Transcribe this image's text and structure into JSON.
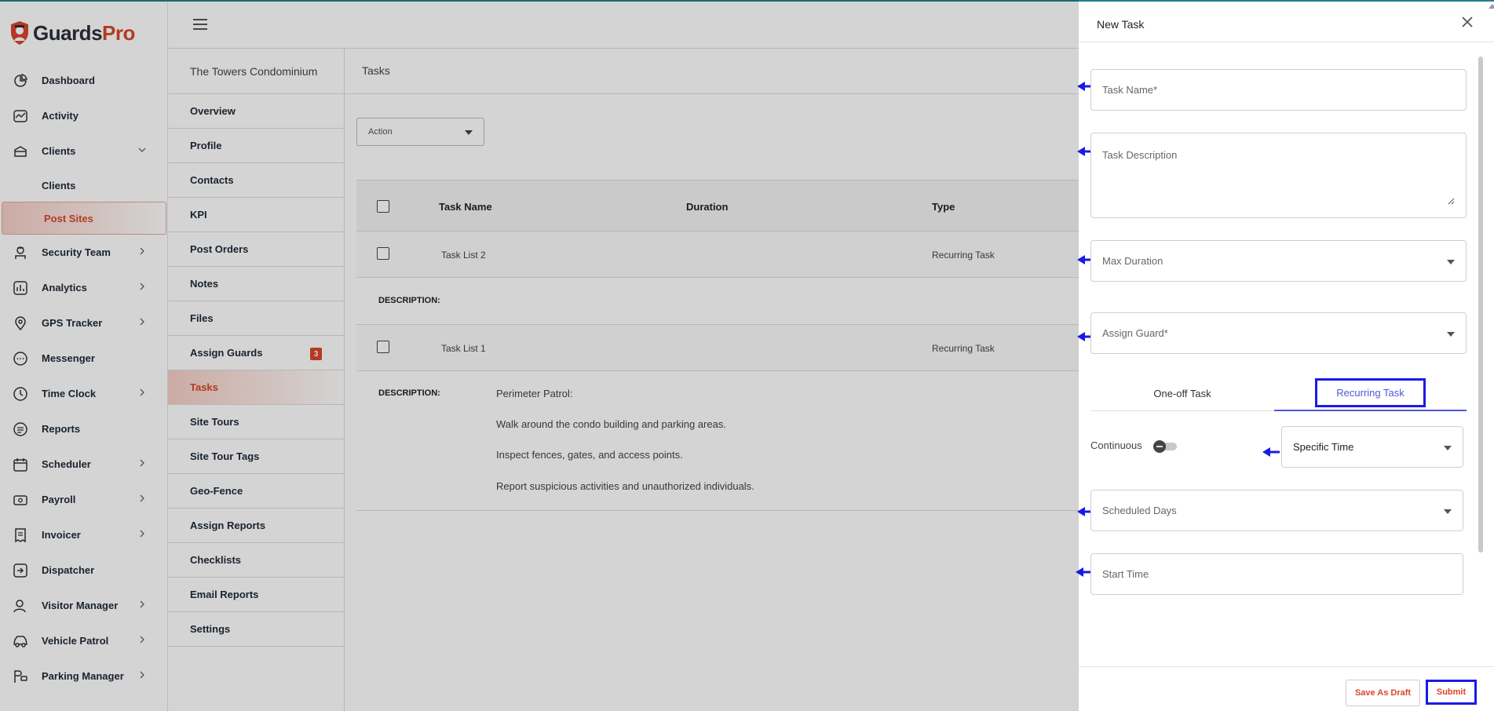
{
  "brand": {
    "name_part1": "Guards",
    "name_part2": "Pro",
    "accent": "#d9462b"
  },
  "sidebar": {
    "items": [
      {
        "label": "Dashboard",
        "icon": "dashboard-icon",
        "chevron": false
      },
      {
        "label": "Activity",
        "icon": "activity-icon",
        "chevron": false
      },
      {
        "label": "Clients",
        "icon": "clients-icon",
        "chevron": "down"
      },
      {
        "label": "Security Team",
        "icon": "security-team-icon",
        "chevron": "right"
      },
      {
        "label": "Analytics",
        "icon": "analytics-icon",
        "chevron": "right"
      },
      {
        "label": "GPS Tracker",
        "icon": "location-pin-icon",
        "chevron": "right"
      },
      {
        "label": "Messenger",
        "icon": "chat-icon",
        "chevron": false
      },
      {
        "label": "Time Clock",
        "icon": "clock-icon",
        "chevron": "right"
      },
      {
        "label": "Reports",
        "icon": "reports-icon",
        "chevron": false
      },
      {
        "label": "Scheduler",
        "icon": "calendar-icon",
        "chevron": "right"
      },
      {
        "label": "Payroll",
        "icon": "payroll-icon",
        "chevron": "right"
      },
      {
        "label": "Invoicer",
        "icon": "invoice-icon",
        "chevron": "right"
      },
      {
        "label": "Dispatcher",
        "icon": "dispatch-icon",
        "chevron": false
      },
      {
        "label": "Visitor Manager",
        "icon": "visitor-icon",
        "chevron": "right"
      },
      {
        "label": "Vehicle Patrol",
        "icon": "car-icon",
        "chevron": "right"
      },
      {
        "label": "Parking Manager",
        "icon": "parking-icon",
        "chevron": "right"
      }
    ],
    "sub_items": [
      "Clients",
      "Post Sites"
    ],
    "active_sub": "Post Sites"
  },
  "site_menu": {
    "title": "The Towers Condominium",
    "items": [
      {
        "label": "Overview"
      },
      {
        "label": "Profile"
      },
      {
        "label": "Contacts"
      },
      {
        "label": "KPI"
      },
      {
        "label": "Post Orders"
      },
      {
        "label": "Notes"
      },
      {
        "label": "Files"
      },
      {
        "label": "Assign Guards",
        "badge": "3"
      },
      {
        "label": "Tasks",
        "active": true
      },
      {
        "label": "Site Tours"
      },
      {
        "label": "Site Tour Tags"
      },
      {
        "label": "Geo-Fence"
      },
      {
        "label": "Assign Reports"
      },
      {
        "label": "Checklists"
      },
      {
        "label": "Email Reports"
      },
      {
        "label": "Settings"
      }
    ]
  },
  "main": {
    "title": "Tasks",
    "action_label": "Action",
    "columns": [
      "Task Name",
      "Duration",
      "Type"
    ],
    "rows": [
      {
        "name": "Task List 2",
        "duration": "",
        "type": "Recurring Task",
        "description_label": "DESCRIPTION:",
        "description": []
      },
      {
        "name": "Task List 1",
        "duration": "",
        "type": "Recurring Task",
        "description_label": "DESCRIPTION:",
        "description": [
          "Perimeter Patrol:",
          "Walk around the condo building and parking areas.",
          "Inspect fences, gates, and access points.",
          "Report suspicious activities and unauthorized individuals."
        ]
      }
    ]
  },
  "drawer": {
    "title": "New Task",
    "task_name_placeholder": "Task Name*",
    "task_description_placeholder": "Task Description",
    "max_duration_placeholder": "Max Duration",
    "assign_guard_placeholder": "Assign Guard*",
    "tabs": [
      "One-off Task",
      "Recurring Task"
    ],
    "active_tab": "Recurring Task",
    "continuous_label": "Continuous",
    "continuous_on": false,
    "time_mode": "Specific Time",
    "scheduled_days_placeholder": "Scheduled Days",
    "start_time_placeholder": "Start Time",
    "save_draft_label": "Save As Draft",
    "submit_label": "Submit",
    "annotation_color": "#1a1ae6"
  }
}
